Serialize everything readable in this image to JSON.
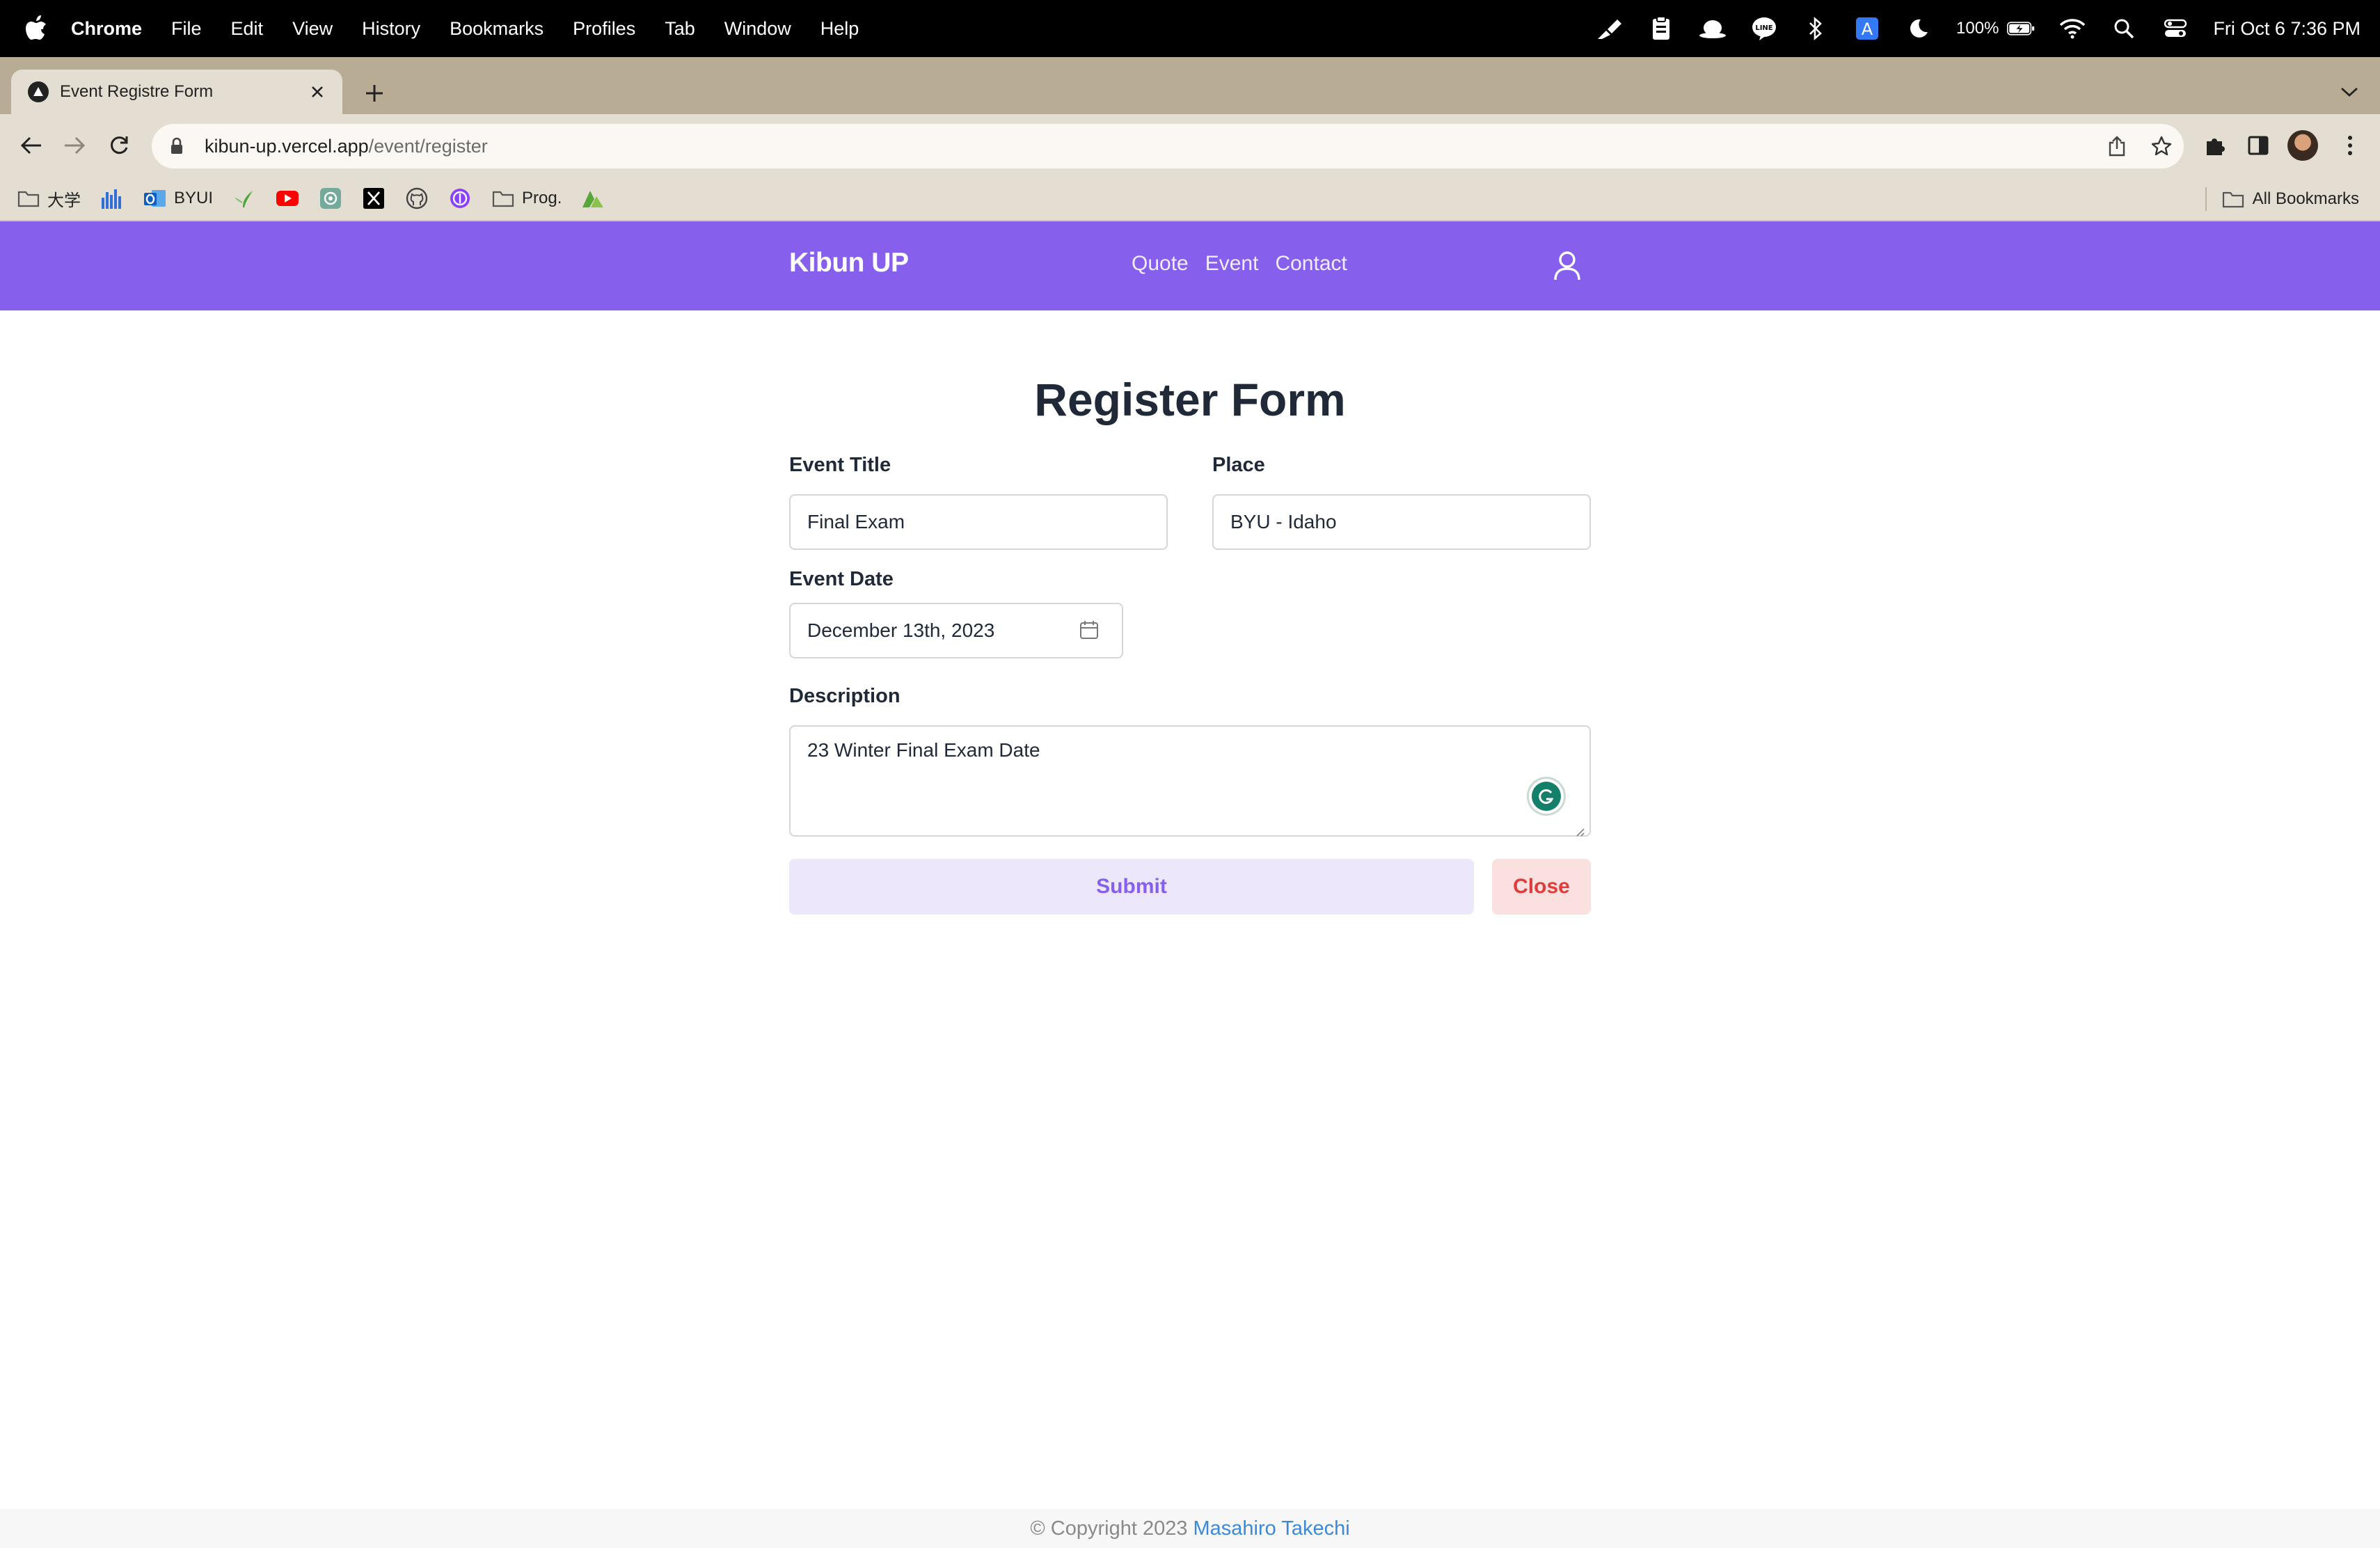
{
  "menubar": {
    "app_name": "Chrome",
    "items": [
      "File",
      "Edit",
      "View",
      "History",
      "Bookmarks",
      "Profiles",
      "Tab",
      "Window",
      "Help"
    ],
    "battery": "100%",
    "clock": "Fri Oct 6  7:36 PM"
  },
  "browser": {
    "tab_title": "Event Registre Form",
    "url_host": "kibun-up.vercel.app",
    "url_path": "/event/register"
  },
  "bookmarks": {
    "items": [
      {
        "icon": "folder-icon",
        "label": "大学"
      },
      {
        "icon": "analytics-icon",
        "label": ""
      },
      {
        "icon": "outlook-icon",
        "label": "BYUI"
      },
      {
        "icon": "sprout-icon",
        "label": ""
      },
      {
        "icon": "youtube-icon",
        "label": ""
      },
      {
        "icon": "chatgpt-icon",
        "label": ""
      },
      {
        "icon": "x-icon",
        "label": ""
      },
      {
        "icon": "github-icon",
        "label": ""
      },
      {
        "icon": "proton-icon",
        "label": ""
      },
      {
        "icon": "folder-icon",
        "label": "Prog."
      },
      {
        "icon": "vercel-like-icon",
        "label": ""
      }
    ],
    "all_label": "All Bookmarks"
  },
  "site": {
    "brand": "Kibun UP",
    "nav": [
      "Quote",
      "Event",
      "Contact"
    ]
  },
  "form": {
    "title": "Register Form",
    "event_title_label": "Event Title",
    "event_title_value": "Final Exam",
    "place_label": "Place",
    "place_value": "BYU - Idaho",
    "event_date_label": "Event Date",
    "event_date_value": "December 13th, 2023",
    "description_label": "Description",
    "description_value": "23 Winter Final Exam Date",
    "submit_label": "Submit",
    "close_label": "Close"
  },
  "footer": {
    "copyright": "© Copyright 2023",
    "author": "Masahiro Takechi"
  },
  "colors": {
    "header_bg": "#8660ec",
    "submit_bg": "#ede7fb",
    "close_bg": "#fbe0e0",
    "close_text": "#e03c3c",
    "author_link": "#3b8ad9"
  }
}
